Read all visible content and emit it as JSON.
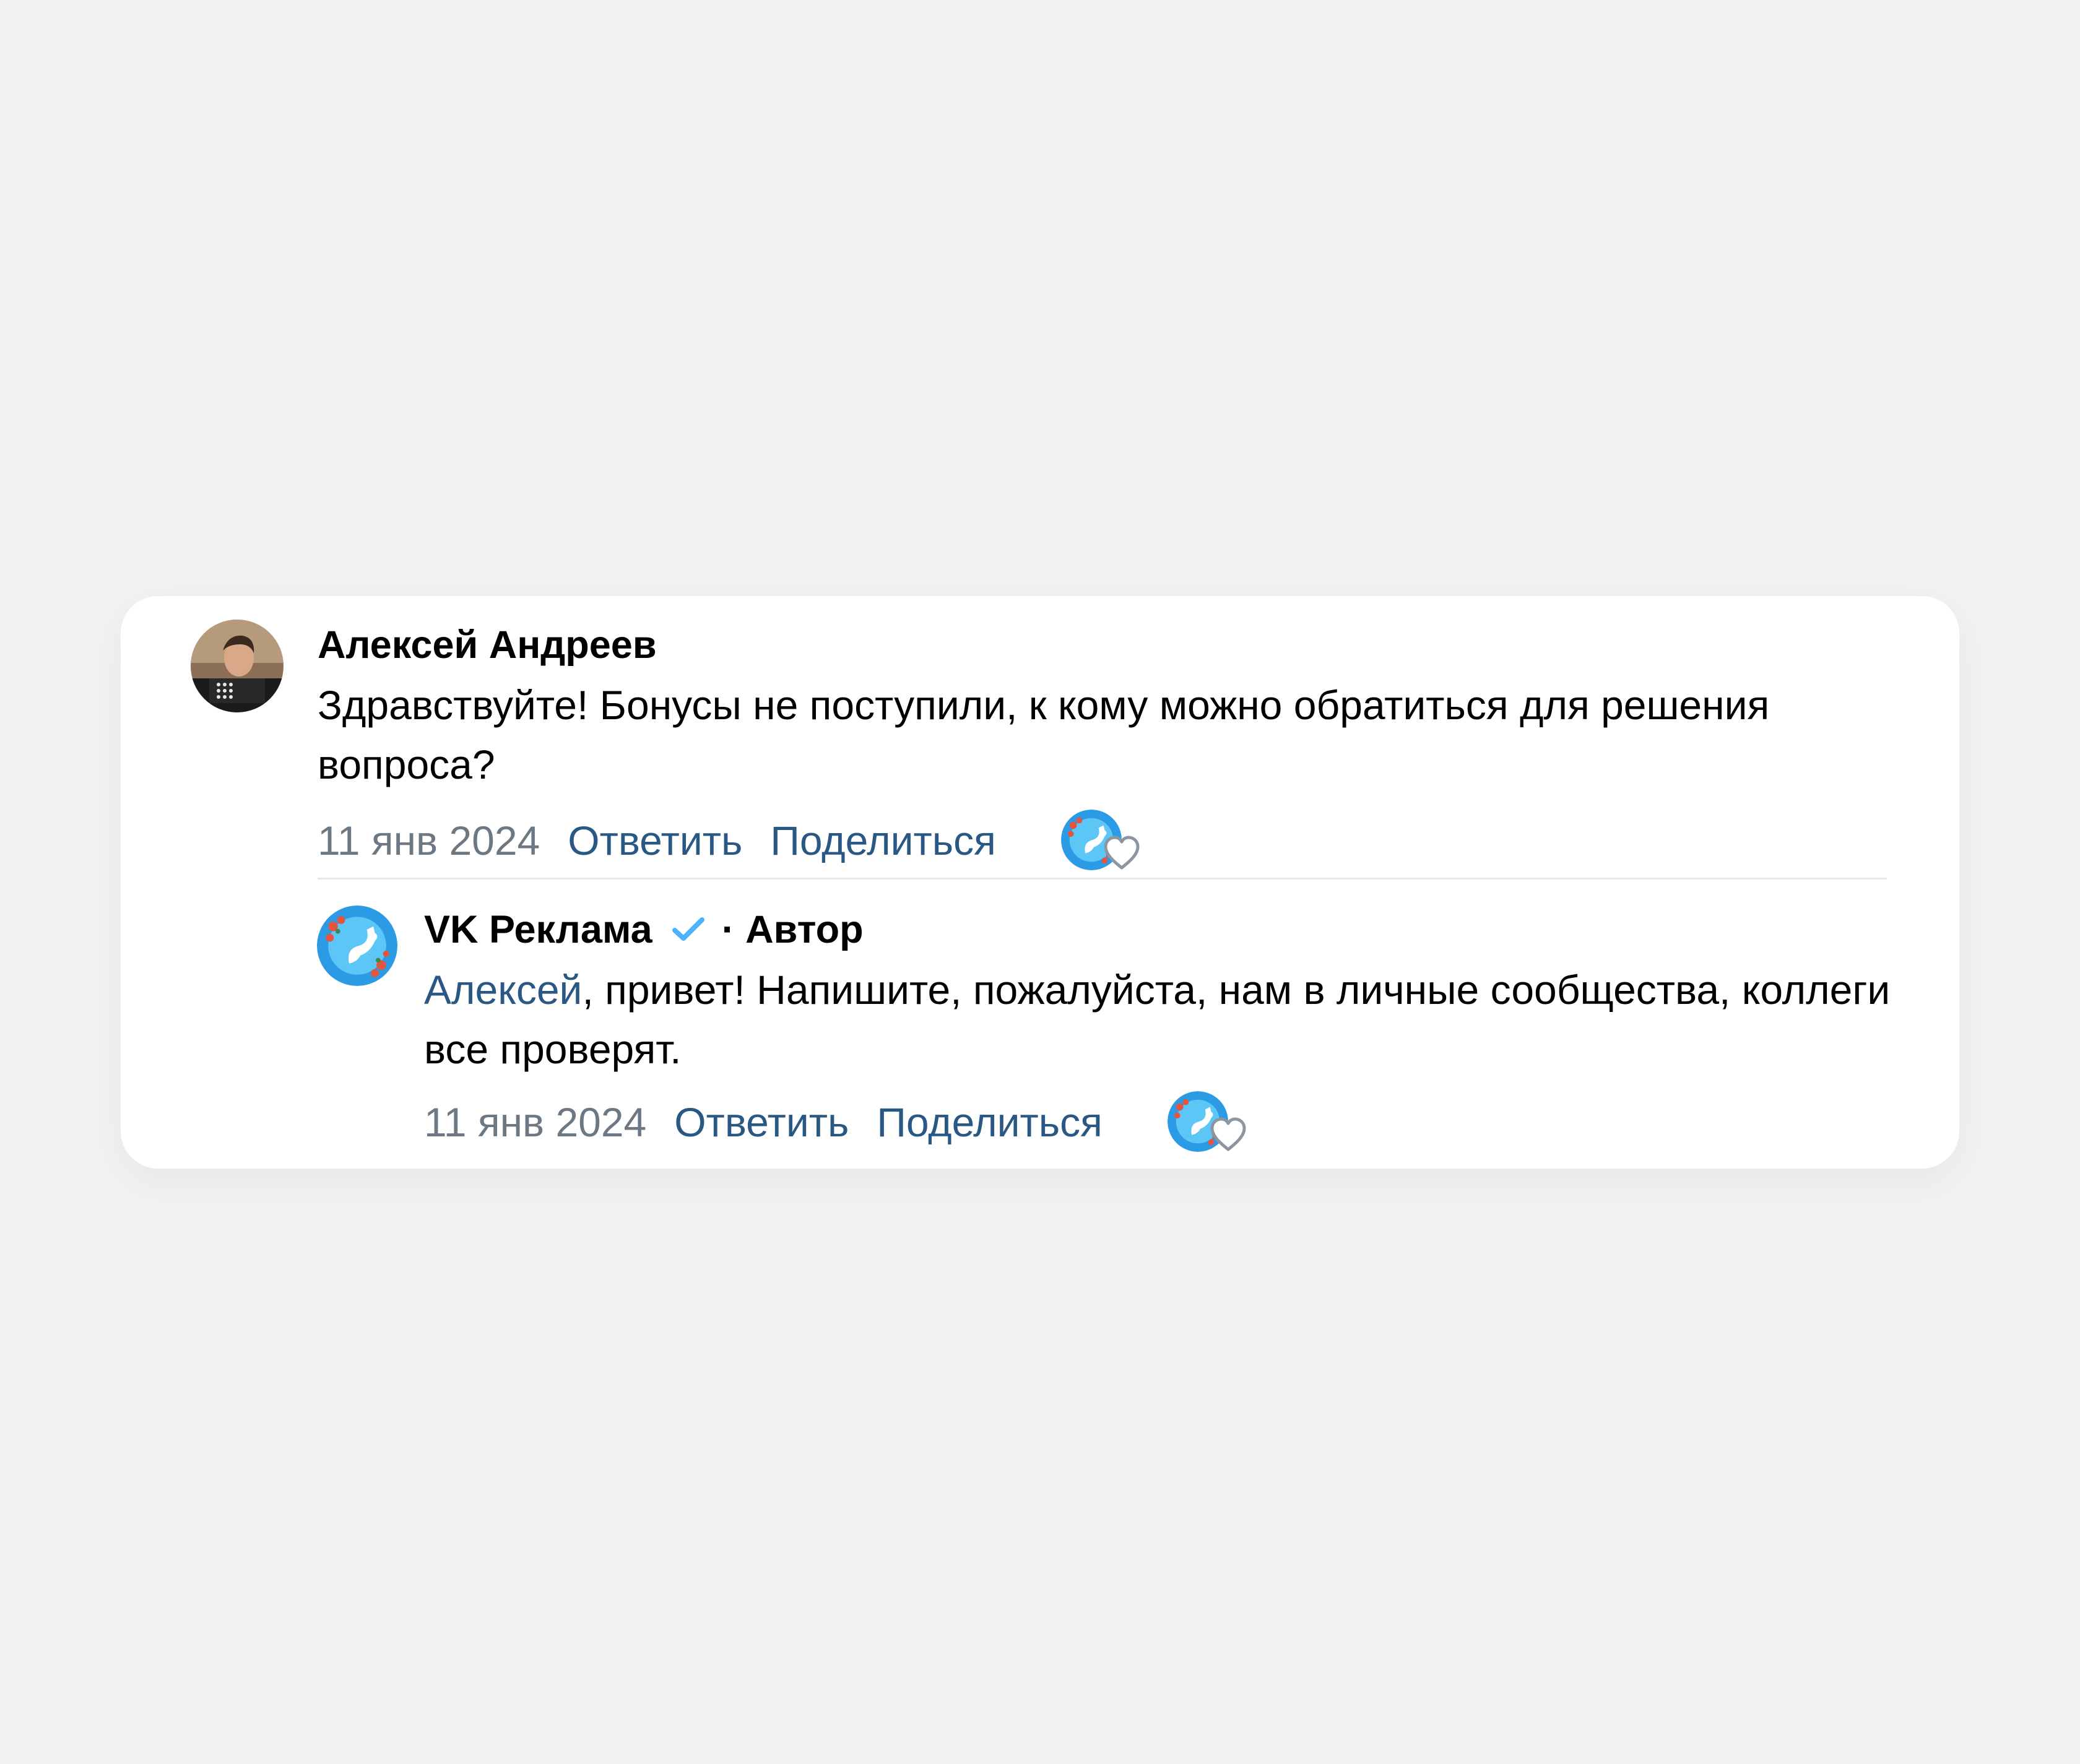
{
  "comment": {
    "author": "Алексей Андреев",
    "text": "Здравствуйте! Бонусы не поступили, к кому можно обратиться для решения вопроса?",
    "date": "11 янв 2024",
    "reply_label": "Ответить",
    "share_label": "Поделиться"
  },
  "reply": {
    "author": "VK Реклама",
    "author_badge": "· Автор",
    "mention": "Алексей",
    "text": ", привет! Напишите, пожалуйста, нам в личные сообщества, коллеги все проверят.",
    "date": "11 янв 2024",
    "reply_label": "Ответить",
    "share_label": "Поделиться"
  },
  "icons": {
    "verified": "verified-check-icon",
    "like": "heart-icon"
  },
  "colors": {
    "background": "#f1f2f4",
    "card": "#ffffff",
    "link": "#2a5885",
    "meta": "#6d7885",
    "verified": "#4bb3fd"
  }
}
